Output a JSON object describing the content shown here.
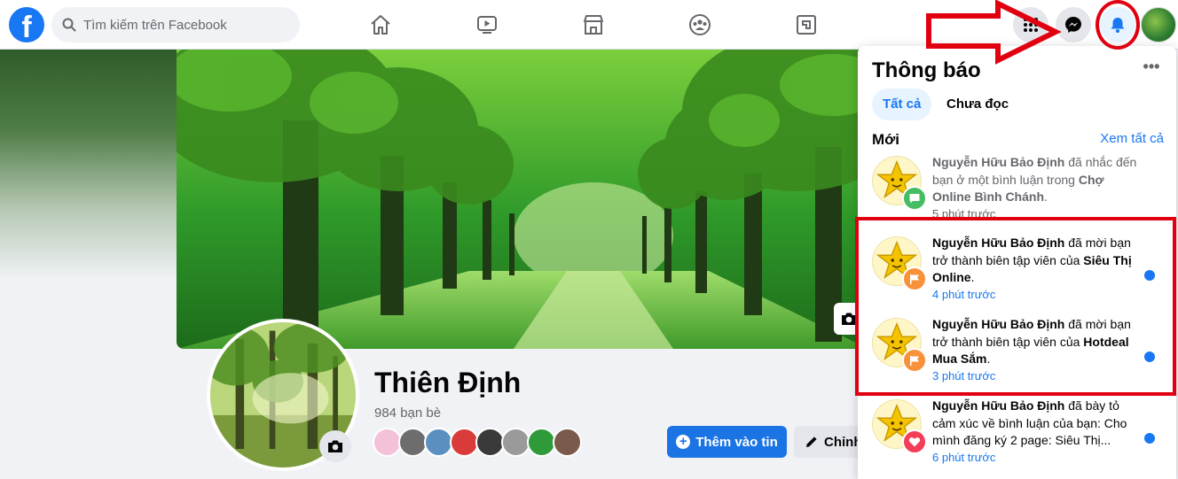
{
  "topbar": {
    "logo": "f",
    "search_placeholder": "Tìm kiếm trên Facebook",
    "nav_icons": [
      "home-icon",
      "watch-icon",
      "marketplace-icon",
      "groups-icon",
      "gaming-icon"
    ],
    "right_icons": [
      "menu-grid-icon",
      "messenger-icon",
      "bell-icon"
    ]
  },
  "profile": {
    "name": "Thiên Định",
    "friends": "984 bạn bè",
    "add_story": "Thêm vào tin",
    "edit": "Chỉnh"
  },
  "notifications": {
    "title": "Thông báo",
    "more": "•••",
    "tabs": [
      "Tất cả",
      "Chưa đọc"
    ],
    "section": "Mới",
    "see_all": "Xem tất cả",
    "items": [
      {
        "actor": "Nguyễn Hữu Bảo Định",
        "text": " đã nhắc đến bạn ở một bình luận trong ",
        "target": "Chợ Online Bình Chánh",
        "end": ".",
        "time": "5 phút trước",
        "badge": "comment-icon",
        "unread": false
      },
      {
        "actor": "Nguyễn Hữu Bảo Định",
        "text": " đã mời bạn trở thành biên tập viên của ",
        "target": "Siêu Thị Online",
        "end": ".",
        "time": "4 phút trước",
        "badge": "flag-icon",
        "unread": true
      },
      {
        "actor": "Nguyễn Hữu Bảo Định",
        "text": " đã mời bạn trở thành biên tập viên của ",
        "target": "Hotdeal Mua Sắm",
        "end": ".",
        "time": "3 phút trước",
        "badge": "flag-icon",
        "unread": true
      },
      {
        "actor": "Nguyễn Hữu Bảo Định",
        "text": " đã bày tỏ cảm xúc về bình luận của bạn: Cho mình đăng ký 2 page: Siêu Thị...",
        "target": "",
        "end": "",
        "time": "6 phút trước",
        "badge": "heart-icon",
        "unread": true
      }
    ]
  },
  "colors": {
    "accent": "#1877f2",
    "annotation": "#e00010"
  }
}
